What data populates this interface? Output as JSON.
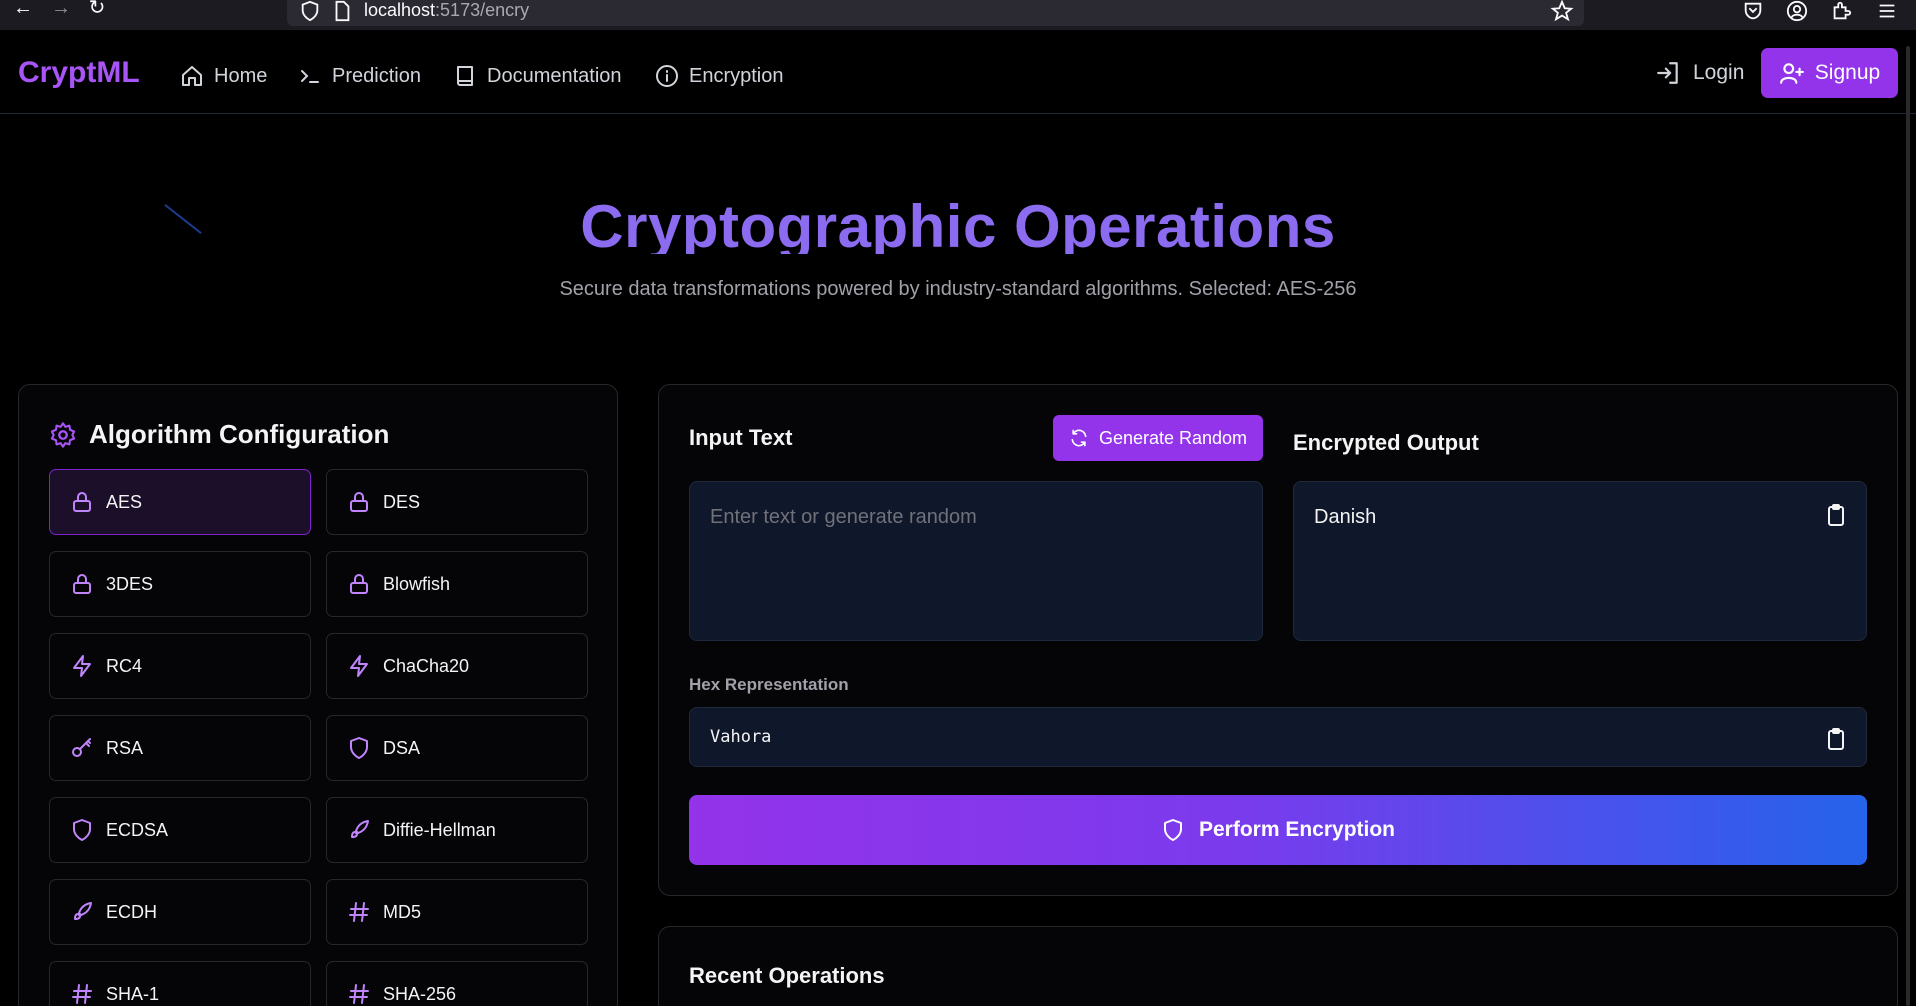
{
  "browser": {
    "url_host": "localhost",
    "url_rest": ":5173/encry"
  },
  "header": {
    "logo": "CryptML",
    "nav": [
      {
        "label": "Home",
        "icon": "home-icon"
      },
      {
        "label": "Prediction",
        "icon": "terminal-icon"
      },
      {
        "label": "Documentation",
        "icon": "book-icon"
      },
      {
        "label": "Encryption",
        "icon": "info-icon"
      }
    ],
    "login_label": "Login",
    "signup_label": "Signup"
  },
  "hero": {
    "title": "Cryptographic Operations",
    "subtitle": "Secure data transformations powered by industry-standard algorithms. Selected: AES-256"
  },
  "config": {
    "title": "Algorithm Configuration",
    "algorithms": [
      {
        "label": "AES",
        "icon": "lock-icon",
        "selected": true
      },
      {
        "label": "DES",
        "icon": "lock-icon"
      },
      {
        "label": "3DES",
        "icon": "lock-icon"
      },
      {
        "label": "Blowfish",
        "icon": "lock-icon"
      },
      {
        "label": "RC4",
        "icon": "lightning-icon"
      },
      {
        "label": "ChaCha20",
        "icon": "lightning-icon"
      },
      {
        "label": "RSA",
        "icon": "key-icon"
      },
      {
        "label": "DSA",
        "icon": "shield-icon"
      },
      {
        "label": "ECDSA",
        "icon": "shield-icon"
      },
      {
        "label": "Diffie-Hellman",
        "icon": "rocket-icon"
      },
      {
        "label": "ECDH",
        "icon": "rocket-icon"
      },
      {
        "label": "MD5",
        "icon": "hash-icon"
      },
      {
        "label": "SHA-1",
        "icon": "hash-icon"
      },
      {
        "label": "SHA-256",
        "icon": "hash-icon"
      }
    ]
  },
  "operation": {
    "input_label": "Input Text",
    "generate_label": "Generate Random",
    "input_placeholder": "Enter text or generate random",
    "output_label": "Encrypted Output",
    "output_value": "Danish",
    "hex_label": "Hex Representation",
    "hex_value": "Vahora",
    "perform_label": "Perform Encryption"
  },
  "recent": {
    "title": "Recent Operations"
  },
  "colors": {
    "accent": "#9333ea",
    "title": "#8b6cf0",
    "gradient_end": "#2563eb"
  }
}
